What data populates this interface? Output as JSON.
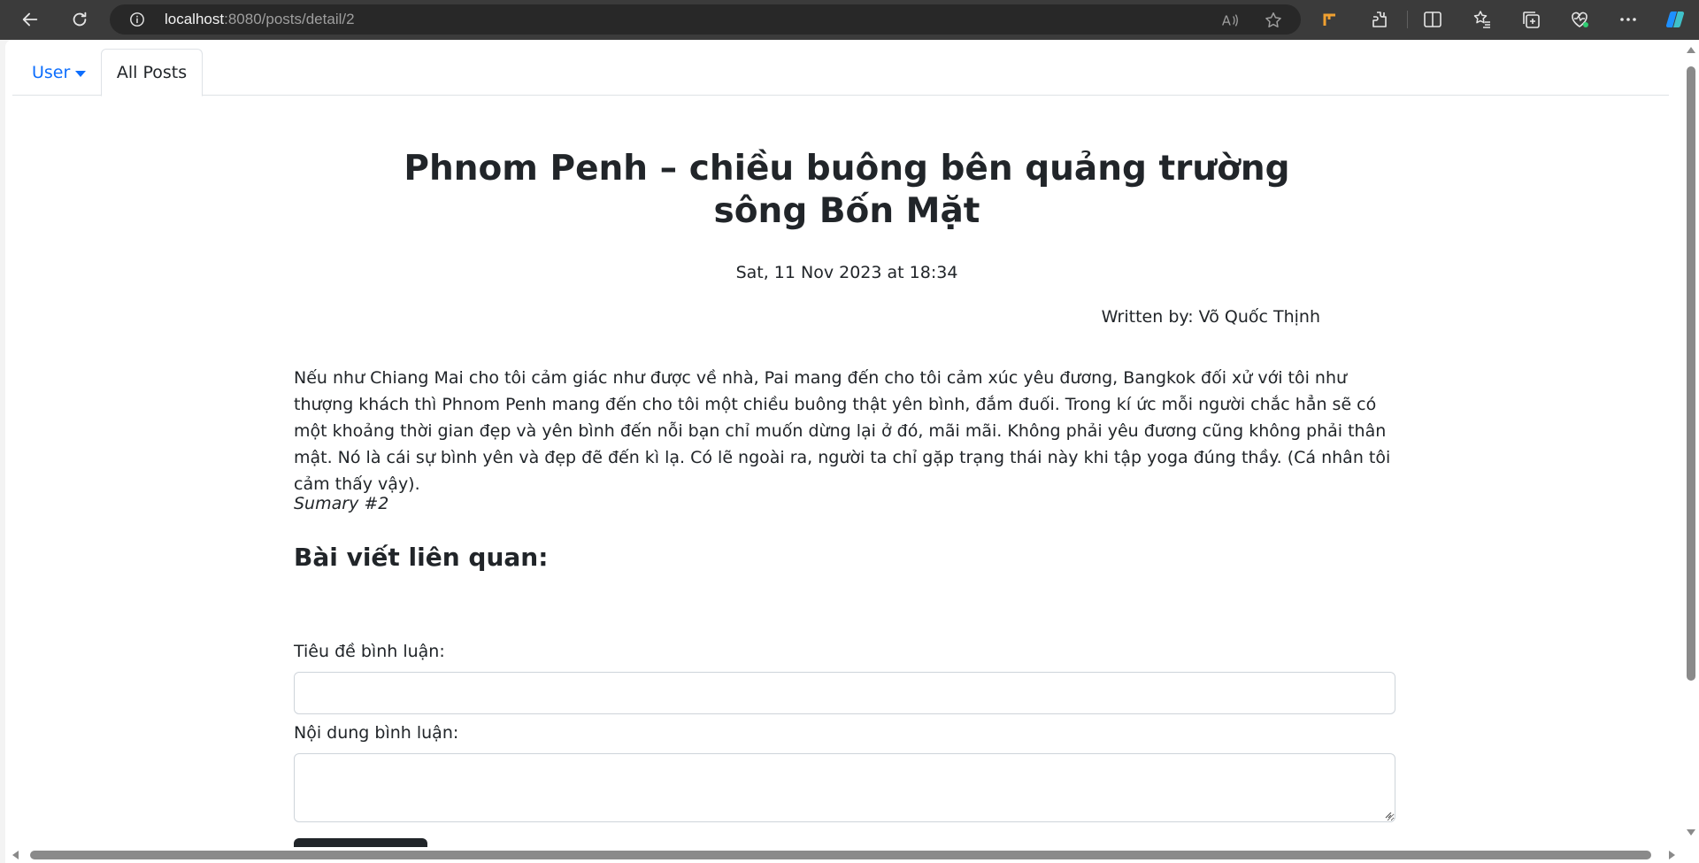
{
  "browser": {
    "url_host": "localhost",
    "url_rest": ":8080/posts/detail/2",
    "icons": [
      "back-icon",
      "refresh-icon",
      "info-icon",
      "read-aloud-icon",
      "favorite-star-icon",
      "extension-orange-icon",
      "extensions-icon",
      "split-screen-icon",
      "favorites-icon",
      "collections-icon",
      "browser-essentials-icon",
      "more-icon",
      "copilot-icon"
    ]
  },
  "tabs": {
    "user_label": "User",
    "all_posts_label": "All Posts"
  },
  "post": {
    "title": "Phnom Penh – chiều buông bên quảng trường sông Bốn Mặt",
    "date": "Sat, 11 Nov 2023 at 18:34",
    "author": "Written by: Võ Quốc Thịnh",
    "content": "Nếu như Chiang Mai cho tôi cảm giác như được về nhà, Pai mang đến cho tôi cảm xúc yêu đương, Bangkok đối xử với tôi như thượng khách thì Phnom Penh mang đến cho tôi một chiều buông thật yên bình, đắm đuối. Trong kí ức mỗi người chắc hẳn sẽ có một khoảng thời gian đẹp và yên bình đến nỗi bạn chỉ muốn dừng lại ở đó, mãi mãi. Không phải yêu đương cũng không phải thân mật. Nó là cái sự bình yên và đẹp đẽ đến kì lạ. Có lẽ ngoài ra, người ta chỉ gặp trạng thái này khi tập yoga đúng thầy. (Cá nhân tôi cảm thấy vậy).",
    "summary": "Sumary #2",
    "related_heading": "Bài viết liên quan:"
  },
  "comment_form": {
    "title_label": "Tiêu đề bình luận:",
    "title_value": "",
    "content_label": "Nội dung bình luận:",
    "content_value": ""
  },
  "colors": {
    "link_blue": "#0d6efd",
    "text": "#212529",
    "chrome_bg": "#3b3b3b",
    "address_bg": "#282828"
  }
}
